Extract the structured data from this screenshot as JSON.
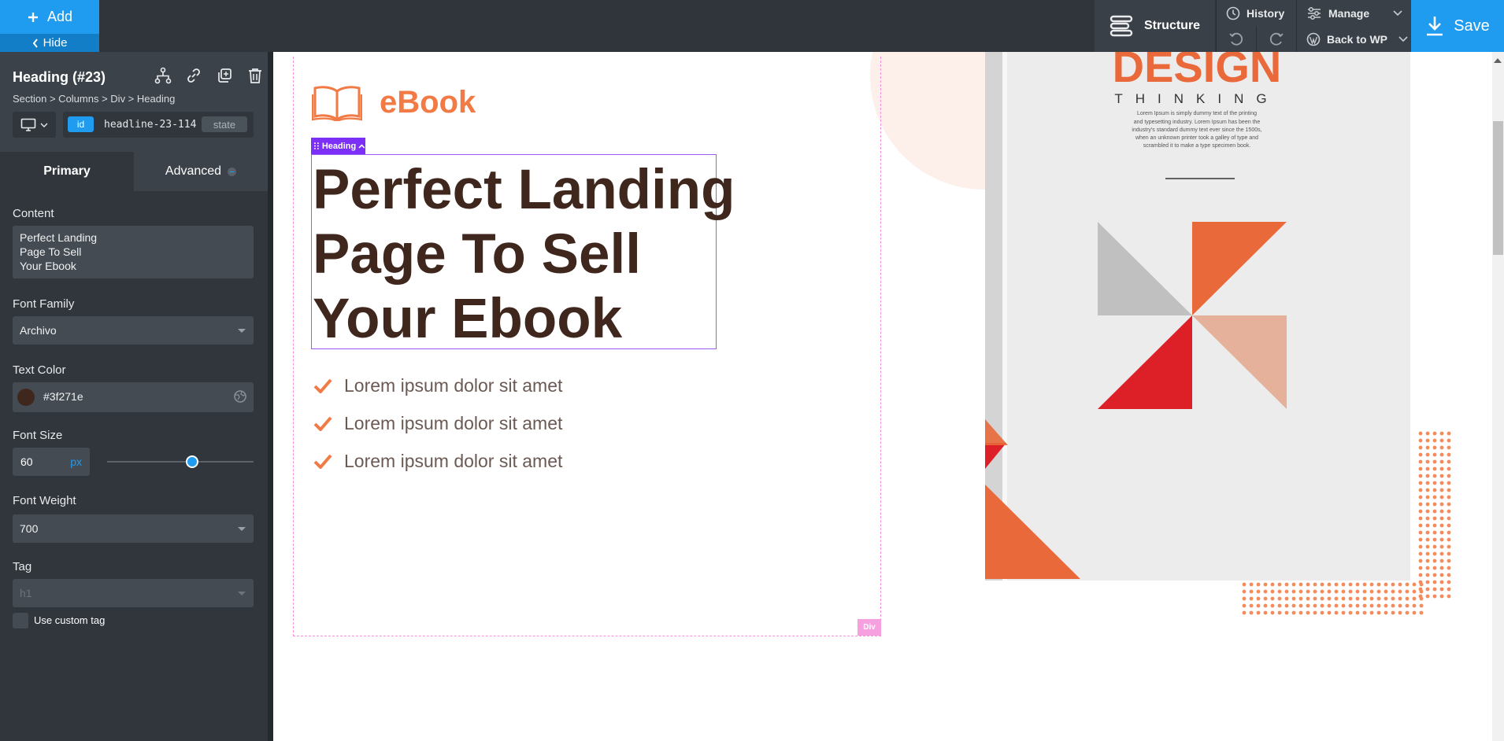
{
  "topbar": {
    "add_label": "Add",
    "hide_label": "Hide",
    "structure_label": "Structure",
    "history_label": "History",
    "manage_label": "Manage",
    "back_label": "Back to WP",
    "save_label": "Save"
  },
  "sidebar": {
    "title": "Heading (#23)",
    "breadcrumb": "Section > Columns > Div > Heading",
    "id_badge": "id",
    "selector": "headline-23-114",
    "state_label": "state",
    "tabs": [
      {
        "label": "Primary"
      },
      {
        "label": "Advanced"
      }
    ],
    "content_label": "Content",
    "content_value": "Perfect Landing\nPage To Sell\nYour Ebook",
    "font_family_label": "Font Family",
    "font_family_value": "Archivo",
    "text_color_label": "Text Color",
    "text_color_value": "#3f271e",
    "font_size_label": "Font Size",
    "font_size_value": "60",
    "font_size_unit": "px",
    "font_weight_label": "Font Weight",
    "font_weight_value": "700",
    "tag_label": "Tag",
    "tag_value": "h1",
    "custom_tag_label": "Use custom tag"
  },
  "canvas": {
    "logo_text": "eBook",
    "heading_tag": "Heading",
    "div_tag": "Div",
    "heading_lines": [
      "Perfect Landing",
      "Page To Sell",
      "Your Ebook"
    ],
    "checklist": [
      "Lorem ipsum dolor sit amet",
      "Lorem ipsum dolor sit amet",
      "Lorem ipsum dolor sit amet"
    ],
    "book": {
      "title": "DESIGN",
      "subtitle": "THINKING",
      "blurb_lines": [
        "Lorem Ipsum is simply dummy text of the printing",
        "and typesetting industry. Lorem Ipsum has been the",
        "industry's standard dummy text ever since the 1500s,",
        "when an unknown printer took a galley of type and",
        "scrambled it to make a type specimen book."
      ]
    }
  },
  "colors": {
    "accent": "#1f9bf0",
    "heading_color": "#3f271e",
    "brand_orange": "#f27a45",
    "selection_purple": "#7b2ff7"
  }
}
